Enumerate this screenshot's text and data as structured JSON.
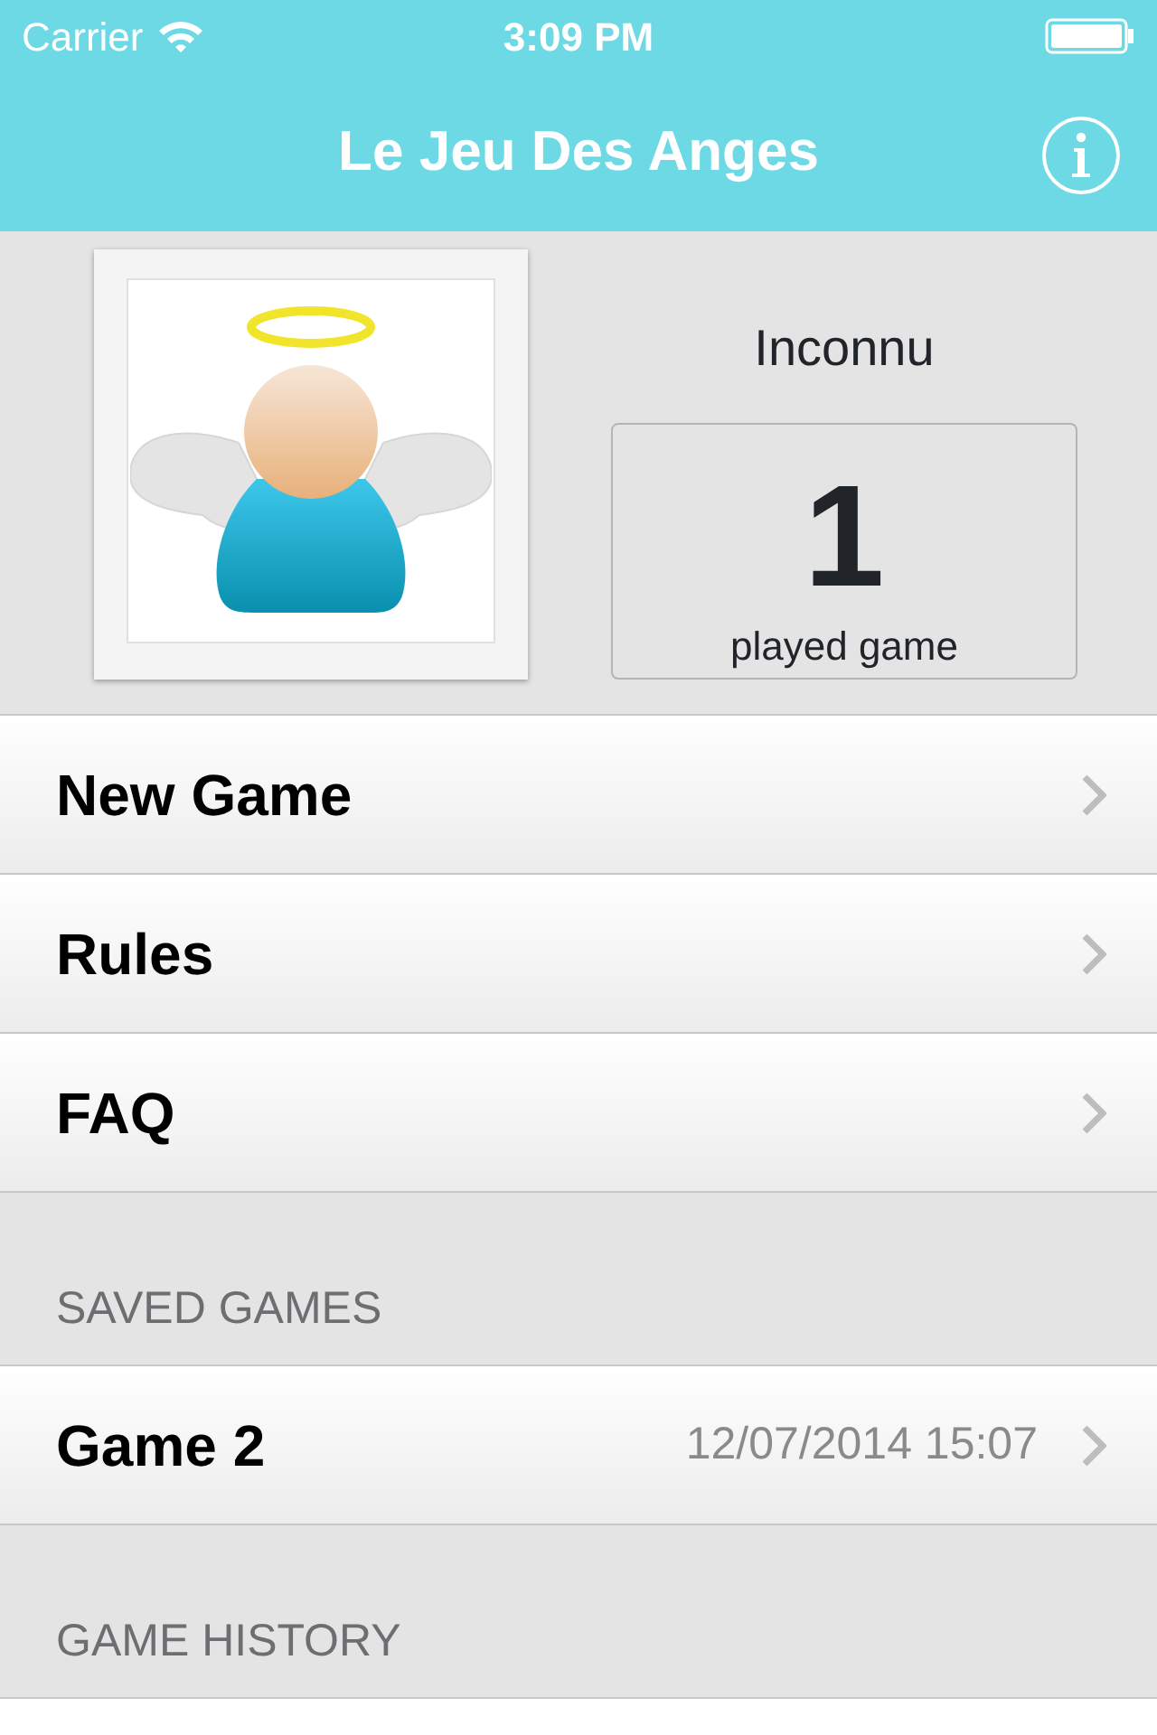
{
  "status_bar": {
    "carrier": "Carrier",
    "time": "3:09 PM"
  },
  "nav_bar": {
    "title": "Le Jeu Des Anges"
  },
  "profile": {
    "name": "Inconnu",
    "count": "1",
    "count_label": "played game"
  },
  "menu": [
    {
      "label": "New Game"
    },
    {
      "label": "Rules"
    },
    {
      "label": "FAQ"
    }
  ],
  "sections": [
    {
      "header": "SAVED GAMES",
      "rows": [
        {
          "label": "Game 2",
          "detail": "12/07/2014 15:07"
        }
      ]
    },
    {
      "header": "GAME HISTORY"
    }
  ]
}
